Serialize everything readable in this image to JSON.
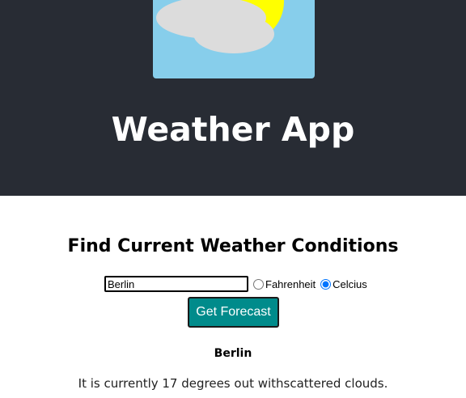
{
  "header": {
    "title": "Weather App",
    "logo": "sun-behind-cloud-icon",
    "colors": {
      "background": "#282c34",
      "logo_sky": "#87ceeb",
      "sun": "#ffff00",
      "cloud": "#dcdcdc"
    }
  },
  "main": {
    "heading": "Find Current Weather Conditions",
    "form": {
      "city_value": "Berlin",
      "units": [
        {
          "label": "Fahrenheit",
          "checked": false
        },
        {
          "label": "Celcius",
          "checked": true
        }
      ],
      "submit_label": "Get Forecast",
      "button_color": "#008b8b"
    },
    "result": {
      "city": "Berlin",
      "description": "It is currently 17 degrees out withscattered clouds."
    }
  }
}
